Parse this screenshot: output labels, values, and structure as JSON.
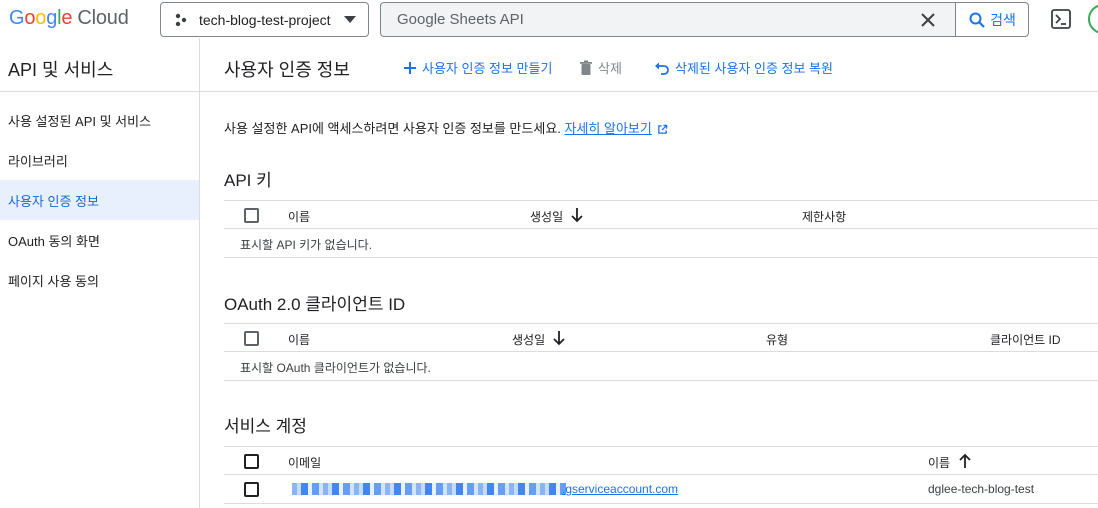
{
  "header": {
    "logo_letters": [
      "G",
      "o",
      "o",
      "g",
      "l",
      "e"
    ],
    "logo_suffix": "Cloud",
    "project": "tech-blog-test-project",
    "search_query": "Google Sheets API",
    "search_button": "검색"
  },
  "sidebar": {
    "title": "API 및 서비스",
    "items": [
      {
        "label": "사용 설정된 API 및 서비스"
      },
      {
        "label": "라이브러리"
      },
      {
        "label": "사용자 인증 정보"
      },
      {
        "label": "OAuth 동의 화면"
      },
      {
        "label": "페이지 사용 동의"
      }
    ],
    "active_index": 2
  },
  "toolbar": {
    "title": "사용자 인증 정보",
    "create_label": "사용자 인증 정보 만들기",
    "delete_label": "삭제",
    "restore_label": "삭제된 사용자 인증 정보 복원"
  },
  "intro": {
    "text": "사용 설정한 API에 액세스하려면 사용자 인증 정보를 만드세요.",
    "link": "자세히 알아보기"
  },
  "api_keys": {
    "title": "API 키",
    "columns": [
      "이름",
      "생성일",
      "제한사항"
    ],
    "empty": "표시할 API 키가 없습니다."
  },
  "oauth": {
    "title": "OAuth 2.0 클라이언트 ID",
    "columns": [
      "이름",
      "생성일",
      "유형",
      "클라이언트 ID"
    ],
    "empty": "표시할 OAuth 클라이언트가 없습니다."
  },
  "service_accounts": {
    "title": "서비스 계정",
    "columns": [
      "이메일",
      "이름"
    ],
    "rows": [
      {
        "email_suffix": ".gserviceaccount.com",
        "name": "dglee-tech-blog-test"
      }
    ]
  },
  "colors": {
    "accent": "#1a73e8",
    "active_bg": "#e8f0fe",
    "divider": "#dadce0"
  }
}
